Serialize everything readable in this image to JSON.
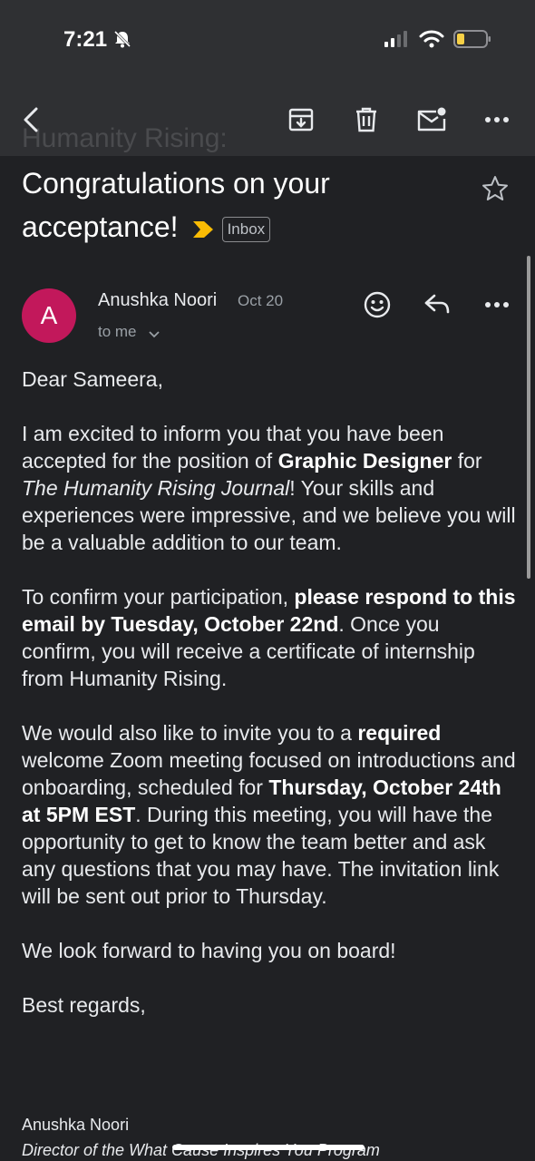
{
  "status_bar": {
    "time": "7:21"
  },
  "toolbar": {
    "back": "back-arrow-icon",
    "archive": "archive-icon",
    "delete": "trash-icon",
    "mark_unread": "mark-unread-icon",
    "more": "more-horizontal-icon",
    "ghost_title": "Humanity Rising:"
  },
  "email": {
    "subject": "Congratulations on your acceptance!",
    "label": "Inbox",
    "label_color": "#fbbc04",
    "sender": {
      "initial": "A",
      "name": "Anushka Noori",
      "date": "Oct 20",
      "recipient": "to me",
      "avatar_color": "#c2185b"
    },
    "greeting": "Dear Sameera,",
    "p1": {
      "t1": "I am excited to inform you that you have been accepted for the position of ",
      "b1": "Graphic Designer",
      "t2": " for ",
      "i1": "The Humanity Rising Journal",
      "t3": "! Your skills and experiences were impressive, and we believe you will be a valuable addition to our team."
    },
    "p2": {
      "t1": "To confirm your participation, ",
      "b1": "please respond to this email by Tuesday, October 22nd",
      "t2": ". Once you confirm, you will receive a certificate of internship from Humanity Rising."
    },
    "p3": {
      "t1": "We would also like to invite you to a ",
      "b1": "required",
      "t2": " welcome Zoom meeting focused on introductions and onboarding, scheduled for ",
      "b2": "Thursday, October 24th at 5PM EST",
      "t3": ". During this meeting, you will have the opportunity to get to know the team better and ask any questions that you may have. The invitation link will be sent out prior to Thursday."
    },
    "p4": "We look forward to having you on board!",
    "closing": "Best regards,",
    "signature": {
      "name": "Anushka Noori",
      "title": "Director of the What Cause Inspires You Program"
    }
  }
}
